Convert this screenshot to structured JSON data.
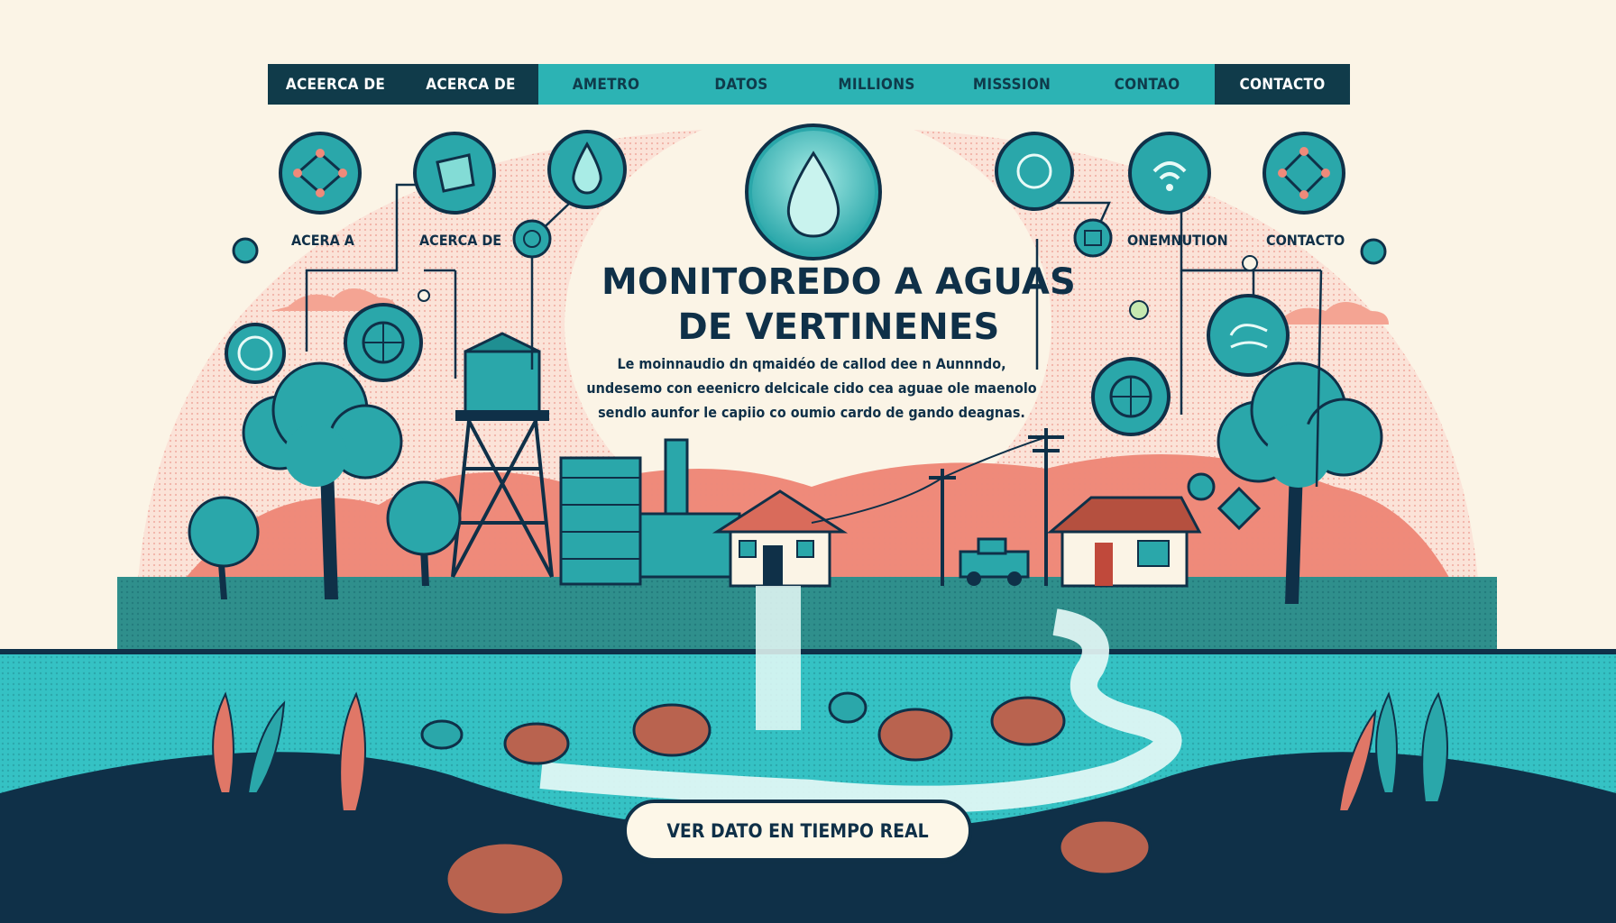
{
  "nav": {
    "items": [
      {
        "label": "ACEERCA DE"
      },
      {
        "label": "ACERCA DE"
      },
      {
        "label": "AMETRO"
      },
      {
        "label": "DATOS"
      },
      {
        "label": "MILLIONS"
      },
      {
        "label": "MISSSION"
      },
      {
        "label": "CONTAO"
      },
      {
        "label": "CONTACTO"
      }
    ]
  },
  "hero": {
    "title_line1": "MONITOREDO A AGUAS",
    "title_line2": "DE VERTINENES",
    "description": [
      "Le moinnaudio dn qmaidéo de callod dee n Aunnndo,",
      "undesemo con eeenicro delcicale cido cea aguae ole maenolo",
      "sendlo aunfor le capiio co oumio cardo de gando deagnas."
    ],
    "cta_label": "VER DATO EN TIEMPO REAL"
  },
  "feature_labels": {
    "left_1": "ACERA A",
    "left_2": "ACERCA DE",
    "right_1": "ONEMNUTION",
    "right_2": "CONTACTO"
  },
  "colors": {
    "navy": "#103b4a",
    "teal": "#2cb3b4",
    "coral": "#ef8a7a",
    "cream": "#fbf4e6",
    "water": "#35c2c4"
  }
}
